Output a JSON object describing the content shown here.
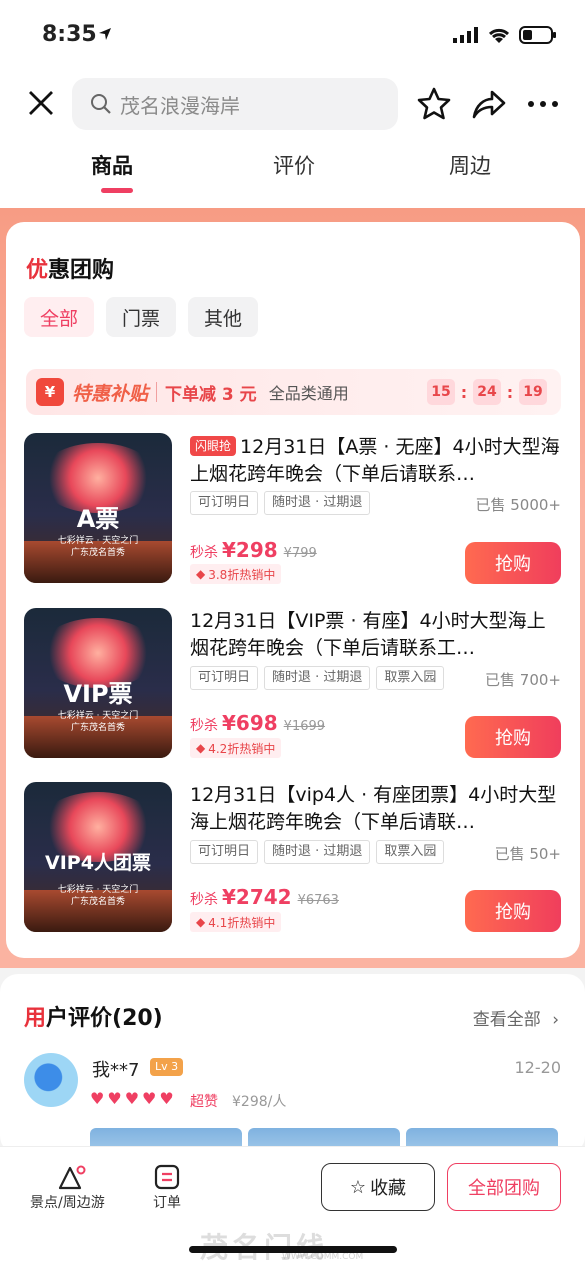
{
  "status_bar": {
    "time": "8:35"
  },
  "nav": {
    "search_placeholder": "茂名浪漫海岸",
    "tabs": [
      {
        "label": "商品",
        "active": true
      },
      {
        "label": "评价",
        "active": false
      },
      {
        "label": "周边",
        "active": false
      }
    ]
  },
  "group": {
    "title_first": "优",
    "title_rest": "惠团购",
    "filters": [
      "全部",
      "门票",
      "其他"
    ],
    "subsidy": {
      "icon": "¥",
      "label": "特惠补贴",
      "offer": "下单减 3 元",
      "scope": "全品类通用",
      "countdown": [
        "15",
        "24",
        "19"
      ]
    },
    "products": [
      {
        "thumb_label": "A票",
        "thumb_caption": "七彩祥云 · 天空之门\n广东茂名首秀",
        "badge": "闪眼抢",
        "title": "12月31日【A票 · 无座】4小时大型海上烟花跨年晚会（下单后请联系…",
        "tags": [
          "可订明日",
          "随时退 · 过期退"
        ],
        "sold": "已售 5000+",
        "price_prefix": "秒杀",
        "price": "¥298",
        "original": "¥799",
        "discount": "3.8折热销中",
        "buy": "抢购"
      },
      {
        "thumb_label": "VIP票",
        "thumb_caption": "七彩祥云 · 天空之门\n广东茂名首秀",
        "badge": "",
        "title": "12月31日【VIP票 · 有座】4小时大型海上烟花跨年晚会（下单后请联系工…",
        "tags": [
          "可订明日",
          "随时退 · 过期退",
          "取票入园"
        ],
        "sold": "已售 700+",
        "price_prefix": "秒杀",
        "price": "¥698",
        "original": "¥1699",
        "discount": "4.2折热销中",
        "buy": "抢购"
      },
      {
        "thumb_label": "VIP4人团票",
        "thumb_caption": "七彩祥云 · 天空之门\n广东茂名首秀",
        "badge": "",
        "title": "12月31日【vip4人 · 有座团票】4小时大型海上烟花跨年晚会（下单后请联…",
        "tags": [
          "可订明日",
          "随时退 · 过期退",
          "取票入园"
        ],
        "sold": "已售 50+",
        "price_prefix": "秒杀",
        "price": "¥2742",
        "original": "¥6763",
        "discount": "4.1折热销中",
        "buy": "抢购"
      }
    ]
  },
  "reviews": {
    "title_first": "用",
    "title_rest": "户评价(20)",
    "see_all": "查看全部",
    "review": {
      "user": "我**7",
      "level": "Lv 3",
      "date": "12-20",
      "rating_hearts": 5,
      "verdict": "超赞",
      "per_person": "¥298/人"
    }
  },
  "bottom_bar": {
    "nearby_label": "景点/周边游",
    "orders_label": "订单",
    "favorite": "收藏",
    "all_groups": "全部团购"
  },
  "watermark": {
    "text": "茂名门线",
    "url": "WWW.CDMM.COM"
  },
  "colors": {
    "accent": "#ef3f62",
    "buy_gradient_start": "#ff6a50"
  }
}
